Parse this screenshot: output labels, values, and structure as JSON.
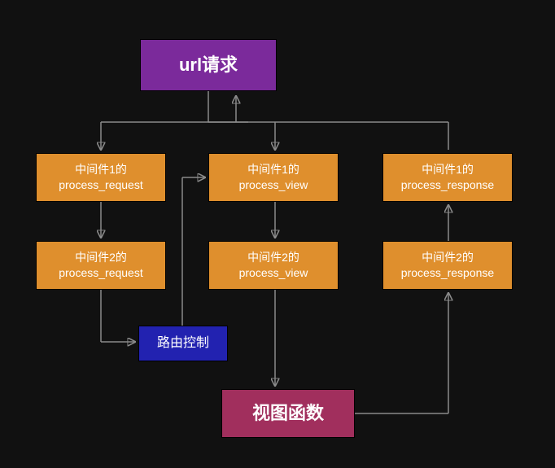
{
  "diagram": {
    "title_node": "url请求",
    "middleware1_request": "中间件1的\nprocess_request",
    "middleware2_request": "中间件2的\nprocess_request",
    "middleware1_view": "中间件1的\nprocess_view",
    "middleware2_view": "中间件2的\nprocess_view",
    "middleware1_response": "中间件1的\nprocess_response",
    "middleware2_response": "中间件2的\nprocess_response",
    "routing_control": "路由控制",
    "view_function": "视图函数",
    "colors": {
      "url_request": "#7b2a9b",
      "middleware": "#df8f2d",
      "routing": "#2222b0",
      "view": "#a12f5d",
      "arrow": "#8b8b8b",
      "background": "#111111"
    }
  }
}
